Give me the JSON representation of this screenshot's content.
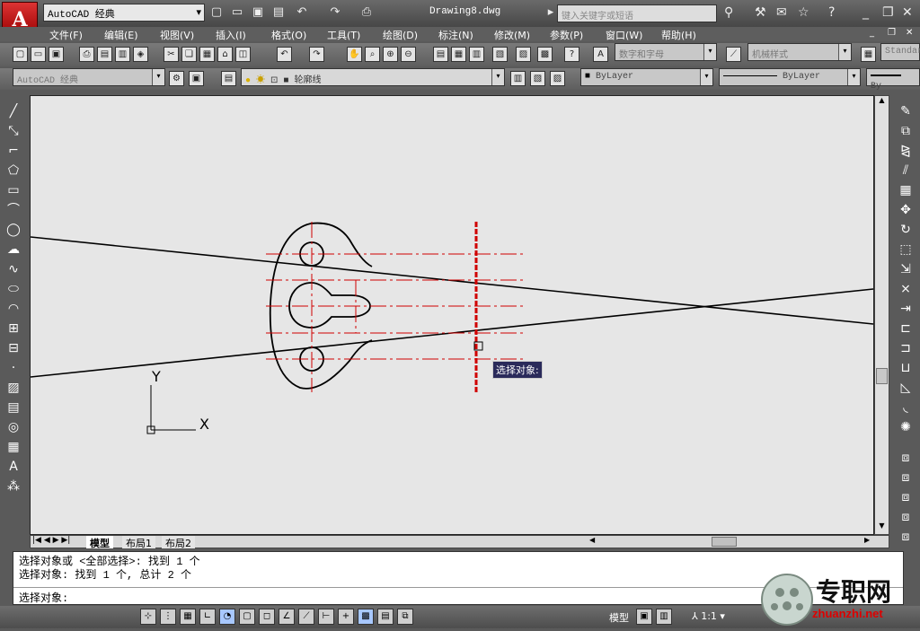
{
  "app": {
    "title": "Drawing8.dwg",
    "workspace": "AutoCAD 经典",
    "logo_letter": "A"
  },
  "search": {
    "placeholder": "键入关键字或短语"
  },
  "menu": [
    "文件(F)",
    "编辑(E)",
    "视图(V)",
    "插入(I)",
    "格式(O)",
    "工具(T)",
    "绘图(D)",
    "标注(N)",
    "修改(M)",
    "参数(P)",
    "窗口(W)",
    "帮助(H)"
  ],
  "toolbar": {
    "text_style": "数字和字母",
    "dim_style": "机械样式",
    "table_style": "Standar",
    "workspace_combo": "AutoCAD 经典",
    "layer": "轮廓线",
    "color": "ByLayer",
    "linetype": "ByLayer",
    "lineweight": "By"
  },
  "canvas": {
    "axis_y": "Y",
    "axis_x": "X",
    "tooltip": "选择对象:"
  },
  "tabs": [
    "模型",
    "布局1",
    "布局2"
  ],
  "command": {
    "lines": [
      "选择对象或 <全部选择>:  找到 1 个",
      "选择对象: 找到 1 个, 总计 2 个"
    ],
    "prompt": "选择对象:"
  },
  "status": {
    "model_label": "模型",
    "scale": "1:1"
  },
  "watermark": {
    "main": "专职网",
    "sub": "zhuanzhi.net"
  },
  "colors": {
    "canvas_bg": "#e6e6e6",
    "center_line": "#d00000",
    "object_line": "#000000",
    "ui_dark": "#5a5a5a"
  }
}
